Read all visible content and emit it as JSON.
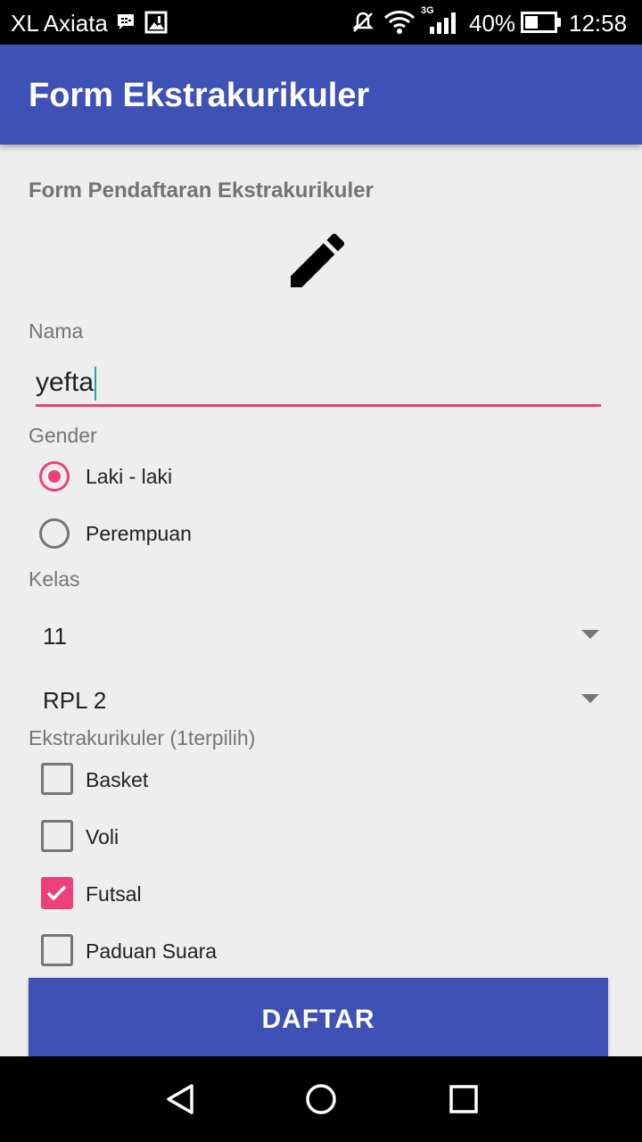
{
  "status_bar": {
    "carrier": "XL Axiata",
    "battery": "40%",
    "time": "12:58",
    "network": "3G",
    "icons": [
      "bbm-icon",
      "image-icon",
      "mute-icon",
      "wifi-icon",
      "signal-icon",
      "battery-icon"
    ]
  },
  "app_bar": {
    "title": "Form Ekstrakurikuler"
  },
  "form": {
    "heading": "Form Pendaftaran Ekstrakurikuler",
    "header_icon": "pencil-icon",
    "name_label": "Nama",
    "name_value": "yefta",
    "gender_label": "Gender",
    "gender_options": [
      {
        "label": "Laki - laki",
        "selected": true
      },
      {
        "label": "Perempuan",
        "selected": false
      }
    ],
    "kelas_label": "Kelas",
    "kelas_value": "11",
    "jurusan_value": "RPL 2",
    "ekskul_label": "Ekstrakurikuler (1terpilih)",
    "ekskul_options": [
      {
        "label": "Basket",
        "checked": false
      },
      {
        "label": "Voli",
        "checked": false
      },
      {
        "label": "Futsal",
        "checked": true
      },
      {
        "label": "Paduan Suara",
        "checked": false
      }
    ],
    "submit_label": "DAFTAR"
  },
  "nav_bar": {
    "icons": [
      "back-icon",
      "home-icon",
      "recents-icon"
    ]
  },
  "colors": {
    "primary": "#3f51b5",
    "accent": "#ec407a",
    "background": "#eeeeee"
  }
}
